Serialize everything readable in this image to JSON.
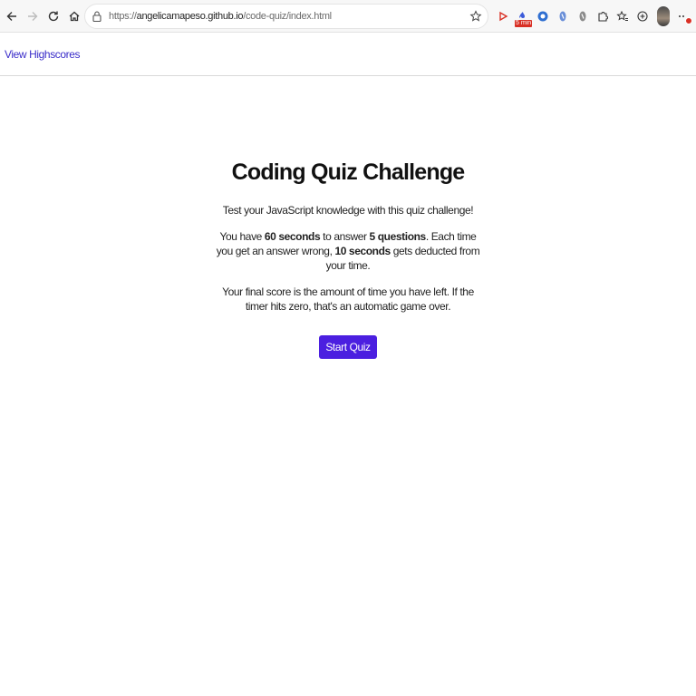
{
  "browser": {
    "url_prefix": "https://",
    "url_host": "angelicamapeso.github.io",
    "url_path": "/code-quiz/index.html",
    "ext_badge": "5 min"
  },
  "nav": {
    "highscores_label": "View Highscores"
  },
  "quiz": {
    "title": "Coding Quiz Challenge",
    "intro": "Test your JavaScript knowledge with this quiz challenge!",
    "rules": {
      "part1": "You have ",
      "time": "60 seconds",
      "part2": " to answer ",
      "count": "5 questions",
      "part3": ". Each time you get an answer wrong, ",
      "penalty": "10 seconds",
      "part4": " gets deducted from your time."
    },
    "score_note": "Your final score is the amount of time you have left. If the timer hits zero, that's an automatic game over.",
    "start_label": "Start Quiz"
  },
  "colors": {
    "accent": "#4b1fe0",
    "link": "#3a2dc9"
  }
}
